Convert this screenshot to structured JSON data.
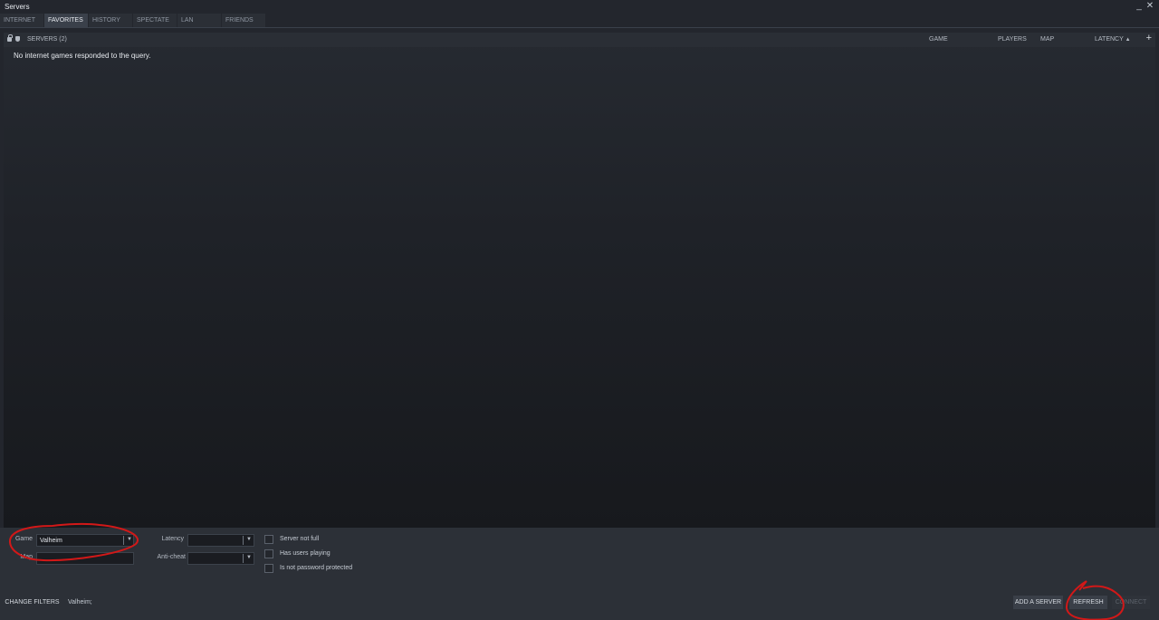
{
  "window": {
    "title": "Servers",
    "minimize_glyph": "_",
    "close_glyph": "✕"
  },
  "tabs": [
    {
      "label": "INTERNET",
      "active": false
    },
    {
      "label": "FAVORITES",
      "active": true
    },
    {
      "label": "HISTORY",
      "active": false
    },
    {
      "label": "SPECTATE",
      "active": false
    },
    {
      "label": "LAN",
      "active": false
    },
    {
      "label": "FRIENDS",
      "active": false
    }
  ],
  "list": {
    "header": {
      "servers": "SERVERS (2)",
      "game": "GAME",
      "players": "PLAYERS",
      "map": "MAP",
      "latency": "LATENCY",
      "latency_sort_glyph": "▲",
      "add_glyph": "+"
    },
    "empty_message": "No internet games responded to the query."
  },
  "filters": {
    "game_label": "Game",
    "game_value": "Valheim",
    "map_label": "Map",
    "map_value": "",
    "latency_label": "Latency",
    "latency_value": "",
    "anticheat_label": "Anti-cheat",
    "anticheat_value": "",
    "checkboxes": [
      {
        "label": "Server not full",
        "checked": false
      },
      {
        "label": "Has users playing",
        "checked": false
      },
      {
        "label": "Is not password protected",
        "checked": false
      }
    ],
    "dropdown_glyph": "▼"
  },
  "footer": {
    "change_filters": "CHANGE FILTERS",
    "filter_summary": "Valheim;",
    "add_server": "ADD A SERVER",
    "refresh": "REFRESH",
    "connect": "CONNECT"
  },
  "colors": {
    "background": "#23262d",
    "panel": "#2c3037",
    "annotation": "#d21818"
  }
}
